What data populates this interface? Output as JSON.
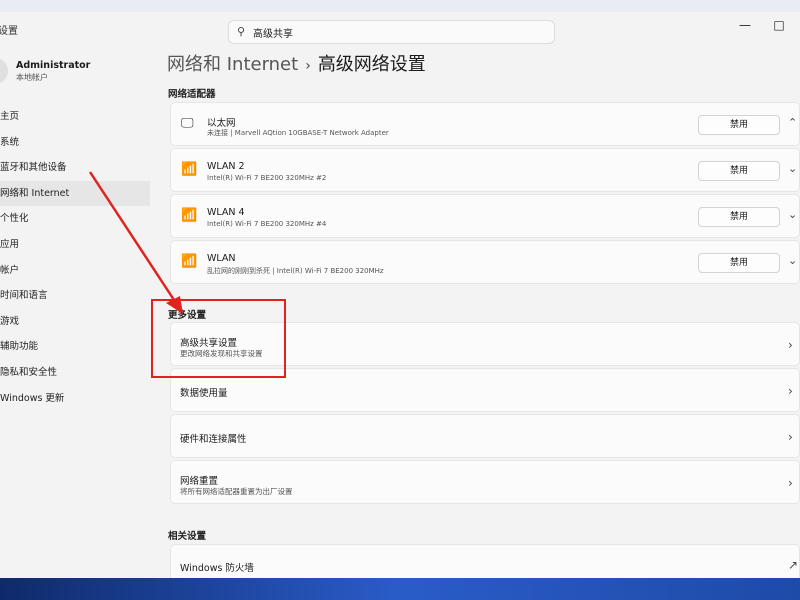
{
  "app": {
    "title": "设置"
  },
  "search": {
    "value": "高级共享"
  },
  "window_controls": {
    "minimize": "—",
    "maximize": "□"
  },
  "profile": {
    "name": "Administrator",
    "subtitle": "本地帐户"
  },
  "nav": {
    "items": [
      {
        "label": "主页"
      },
      {
        "label": "系统"
      },
      {
        "label": "蓝牙和其他设备"
      },
      {
        "label": "网络和 Internet",
        "active": true
      },
      {
        "label": "个性化"
      },
      {
        "label": "应用"
      },
      {
        "label": "帐户"
      },
      {
        "label": "时间和语言"
      },
      {
        "label": "游戏"
      },
      {
        "label": "辅助功能"
      },
      {
        "label": "隐私和安全性"
      },
      {
        "label": "Windows 更新"
      }
    ]
  },
  "breadcrumb": {
    "parent": "网络和 Internet",
    "separator": "›",
    "current": "高级网络设置"
  },
  "adapters": {
    "title": "网络适配器",
    "items": [
      {
        "name": "以太网",
        "desc": "未连接 | Marvell AQtion 10GBASE-T Network Adapter",
        "button": "禁用",
        "icon": "ethernet-icon"
      },
      {
        "name": "WLAN 2",
        "desc": "Intel(R) Wi-Fi 7 BE200 320MHz #2",
        "button": "禁用",
        "icon": "wifi-icon"
      },
      {
        "name": "WLAN 4",
        "desc": "Intel(R) Wi-Fi 7 BE200 320MHz #4",
        "button": "禁用",
        "icon": "wifi-icon"
      },
      {
        "name": "WLAN",
        "desc": "乱拉网的刚刚到杀死 | Intel(R) Wi-Fi 7 BE200 320MHz",
        "button": "禁用",
        "icon": "wifi-icon"
      }
    ]
  },
  "more_settings": {
    "title": "更多设置",
    "items": [
      {
        "title": "高级共享设置",
        "subtitle": "更改网络发现和共享设置"
      },
      {
        "title": "数据使用量",
        "subtitle": ""
      },
      {
        "title": "硬件和连接属性",
        "subtitle": ""
      },
      {
        "title": "网络重置",
        "subtitle": "将所有网络适配器重置为出厂设置"
      }
    ]
  },
  "related": {
    "title": "相关设置",
    "items": [
      {
        "title": "Windows 防火墙"
      }
    ]
  },
  "colors": {
    "annotation": "#e0231f",
    "background": "#f3f3f3",
    "card": "#fbfbfb"
  }
}
